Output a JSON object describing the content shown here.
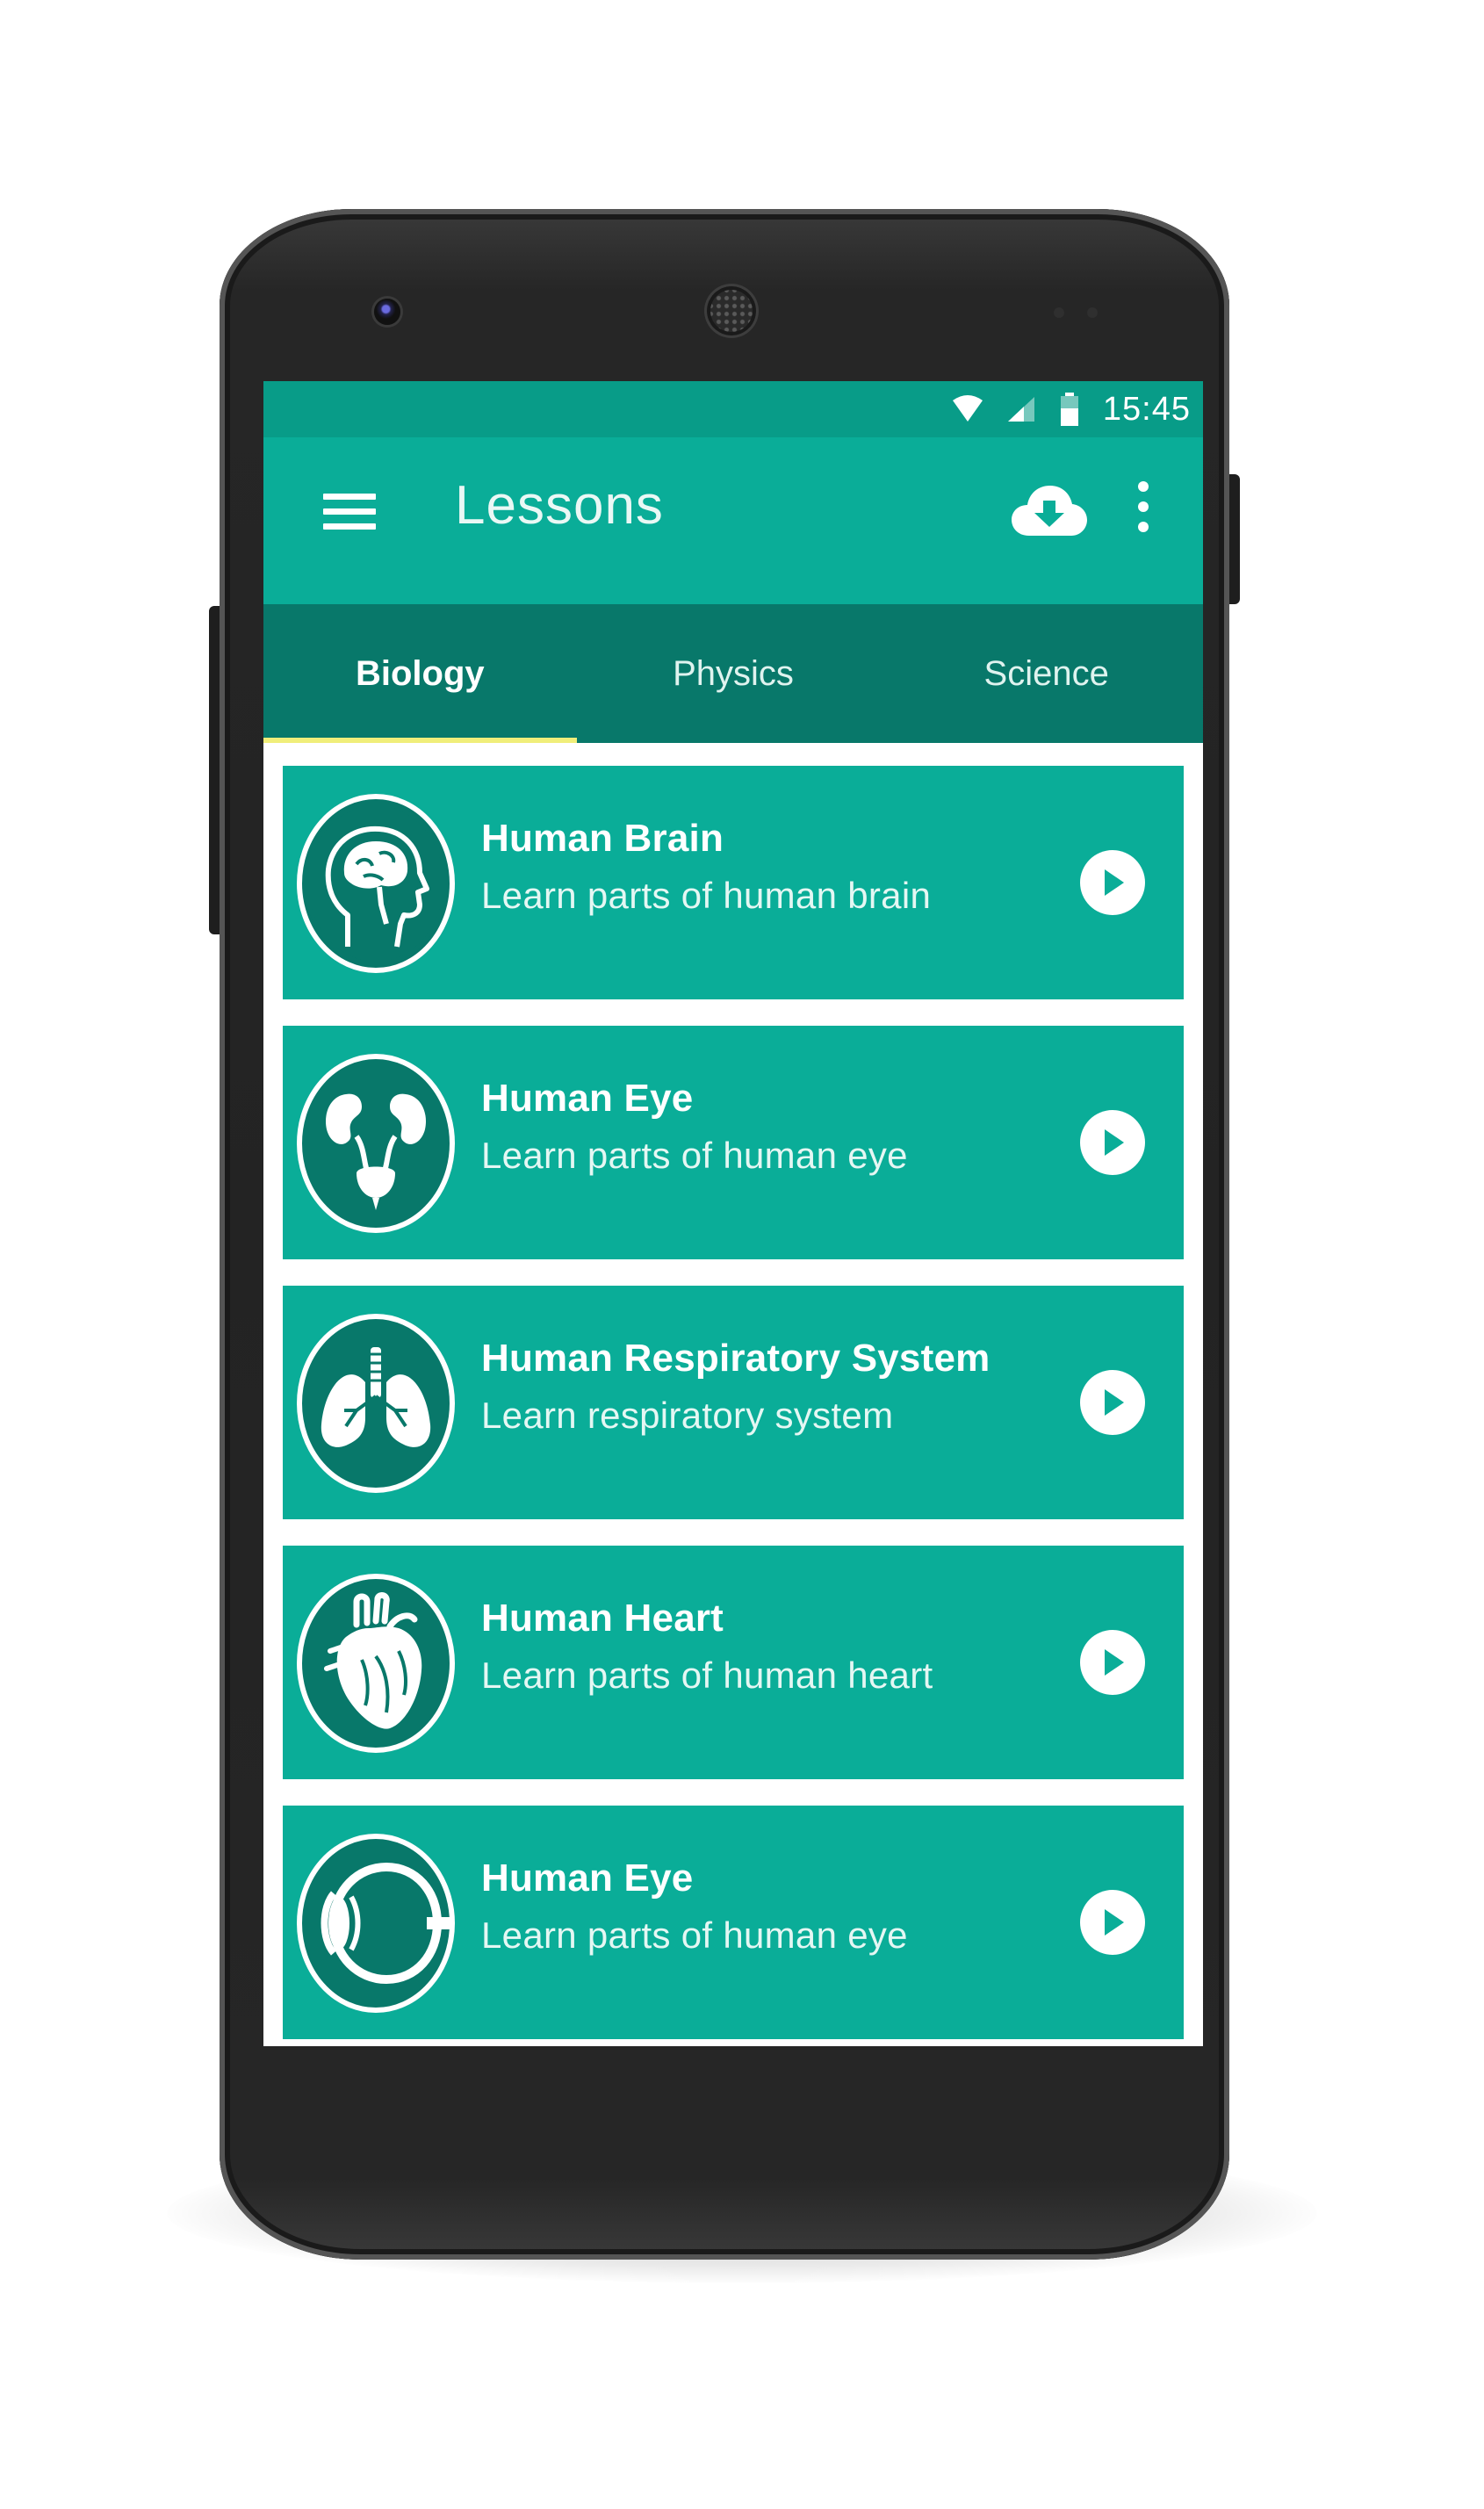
{
  "status_bar": {
    "time": "15:45"
  },
  "app_bar": {
    "title": "Lessons",
    "menu_icon": "hamburger-menu-icon",
    "download_icon": "cloud-download-icon",
    "more_icon": "more-vert-icon"
  },
  "tabs": [
    {
      "label": "Biology",
      "active": true
    },
    {
      "label": "Physics",
      "active": false
    },
    {
      "label": "Science",
      "active": false
    }
  ],
  "lessons": [
    {
      "title": "Human Brain",
      "subtitle": "Learn parts of human brain",
      "icon": "brain-head-icon"
    },
    {
      "title": "Human Eye",
      "subtitle": "Learn parts of human eye",
      "icon": "kidneys-icon"
    },
    {
      "title": "Human Respiratory System",
      "subtitle": "Learn respiratory system",
      "icon": "lungs-icon"
    },
    {
      "title": "Human Heart",
      "subtitle": "Learn parts of human heart",
      "icon": "heart-icon"
    },
    {
      "title": "Human Eye",
      "subtitle": "Learn parts of human eye",
      "icon": "eye-icon"
    }
  ],
  "colors": {
    "primary": "#0aad98",
    "primary_dark": "#08786a",
    "status_bar": "#089c88",
    "icon_circle": "#08786a",
    "tab_indicator": "#f0ee7a"
  }
}
